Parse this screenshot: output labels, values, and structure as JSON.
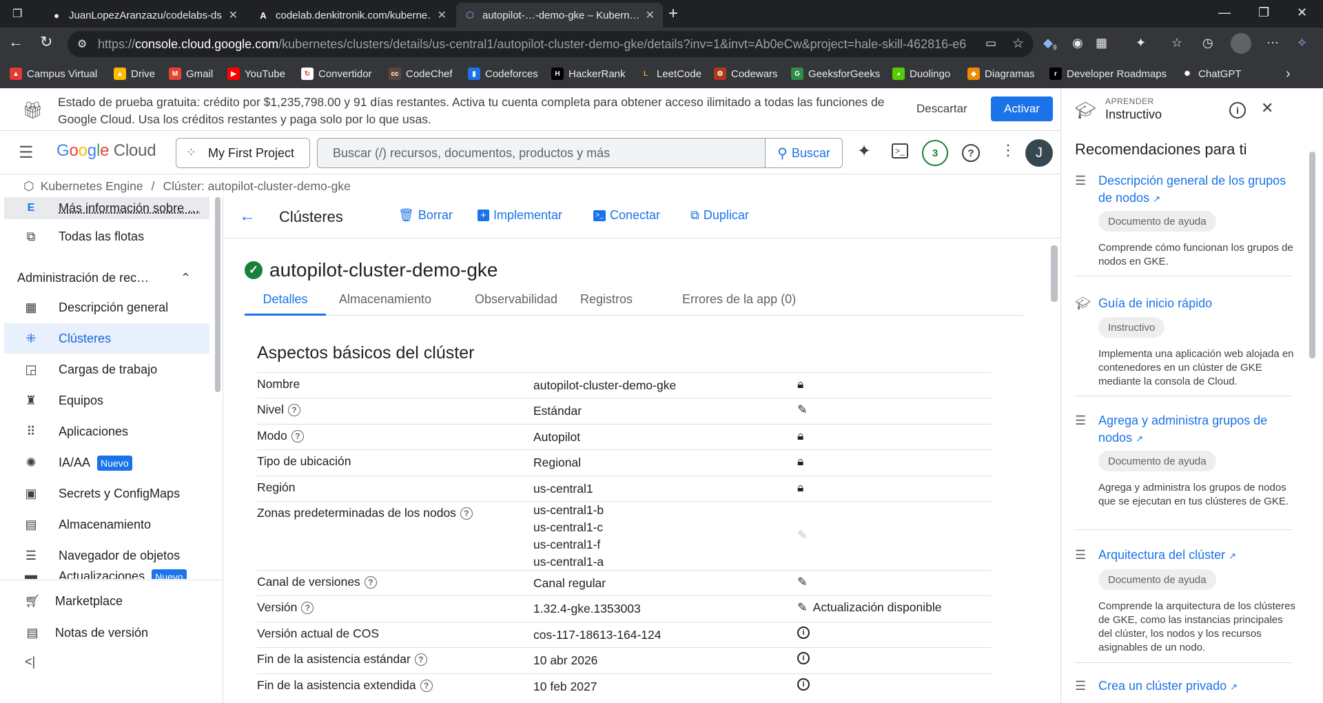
{
  "browser": {
    "tabs": [
      {
        "label": "JuanLopezAranzazu/codelabs-ds…",
        "icon": "github-icon"
      },
      {
        "label": "codelab.denkitronik.com/kuberne…",
        "icon": "codelab-icon"
      },
      {
        "label": "autopilot-…-demo-gke – Kubern…",
        "icon": "kubernetes-icon"
      }
    ],
    "url_prefix": "https://",
    "url_host": "console.cloud.google.com",
    "url_path": "/kubernetes/clusters/details/us-central1/autopilot-cluster-demo-gke/details?inv=1&invt=Ab0eCw&project=hale-skill-462816-e6",
    "extension_badge": "9",
    "bookmarks": [
      "Campus Virtual",
      "Drive",
      "Gmail",
      "YouTube",
      "Convertidor",
      "CodeChef",
      "Codeforces",
      "HackerRank",
      "LeetCode",
      "Codewars",
      "GeeksforGeeks",
      "Duolingo",
      "Diagramas",
      "Developer Roadmaps",
      "ChatGPT"
    ]
  },
  "banner": {
    "text": "Estado de prueba gratuita: crédito por $1,235,798.00 y 91 días restantes. Activa tu cuenta completa para obtener acceso ilimitado a todas las funciones de Google Cloud. Usa los créditos restantes y paga solo por lo que usas.",
    "dismiss": "Descartar",
    "activate": "Activar"
  },
  "topbar": {
    "logo": "Google Cloud",
    "project": "My First Project",
    "search_placeholder": "Buscar (/) recursos, documentos, productos y más",
    "search_button": "Buscar",
    "notifications": "3",
    "avatar": "J"
  },
  "breadcrumb": {
    "product": "Kubernetes Engine",
    "separator": "/",
    "current": "Clúster: autopilot-cluster-demo-gke"
  },
  "leftnav": {
    "top_item": "Más información sobre …",
    "fleets": "Todas las flotas",
    "section": "Administración de rec…",
    "items": [
      {
        "label": "Descripción general",
        "icon": "overview-icon"
      },
      {
        "label": "Clústeres",
        "icon": "clusters-icon"
      },
      {
        "label": "Cargas de trabajo",
        "icon": "workloads-icon"
      },
      {
        "label": "Equipos",
        "icon": "teams-icon"
      },
      {
        "label": "Aplicaciones",
        "icon": "apps-icon"
      },
      {
        "label": "IA/AA",
        "icon": "ai-icon",
        "badge": "Nuevo"
      },
      {
        "label": "Secrets y ConfigMaps",
        "icon": "secrets-icon"
      },
      {
        "label": "Almacenamiento",
        "icon": "storage-icon"
      },
      {
        "label": "Navegador de objetos",
        "icon": "object-browser-icon"
      },
      {
        "label": "Actualizaciones",
        "icon": "upgrades-icon",
        "badge": "Nuevo"
      }
    ],
    "marketplace": "Marketplace",
    "release_notes": "Notas de versión"
  },
  "main": {
    "title": "Clústeres",
    "actions": {
      "delete": "Borrar",
      "deploy": "Implementar",
      "connect": "Conectar",
      "duplicate": "Duplicar"
    },
    "cluster_name": "autopilot-cluster-demo-gke",
    "tabs": [
      "Detalles",
      "Almacenamiento",
      "Observabilidad",
      "Registros",
      "Errores de la app (0)"
    ],
    "section_title": "Aspectos básicos del clúster",
    "rows": [
      {
        "key": "Nombre",
        "value": "autopilot-cluster-demo-gke",
        "action": "lock"
      },
      {
        "key": "Nivel",
        "value": "Estándar",
        "action": "edit",
        "help": true
      },
      {
        "key": "Modo",
        "value": "Autopilot",
        "action": "lock",
        "help": true
      },
      {
        "key": "Tipo de ubicación",
        "value": "Regional",
        "action": "lock"
      },
      {
        "key": "Región",
        "value": "us-central1",
        "action": "lock"
      },
      {
        "key": "Zonas predeterminadas de los nodos",
        "values": [
          "us-central1-b",
          "us-central1-c",
          "us-central1-f",
          "us-central1-a"
        ],
        "action": "edit-disabled",
        "help": true
      },
      {
        "key": "Canal de versiones",
        "value": "Canal regular",
        "action": "edit",
        "help": true
      },
      {
        "key": "Versión",
        "value": "1.32.4-gke.1353003",
        "action": "edit",
        "action_label": "Actualización disponible",
        "help": true
      },
      {
        "key": "Versión actual de COS",
        "value": "cos-117-18613-164-124",
        "action": "info"
      },
      {
        "key": "Fin de la asistencia estándar",
        "value": "10 abr 2026",
        "action": "info",
        "help": true
      },
      {
        "key": "Fin de la asistencia extendida",
        "value": "10 feb 2027",
        "action": "info",
        "help": true
      }
    ]
  },
  "rightpanel": {
    "kicker": "APRENDER",
    "title": "Instructivo",
    "heading": "Recomendaciones para ti",
    "recs": [
      {
        "title": "Descripción general de los grupos de nodos",
        "chip": "Documento de ayuda",
        "desc": "Comprende cómo funcionan los grupos de nodos en GKE.",
        "external": true
      },
      {
        "title": "Guía de inicio rápido",
        "chip": "Instructivo",
        "desc": "Implementa una aplicación web alojada en contenedores en un clúster de GKE mediante la consola de Cloud.",
        "external": false
      },
      {
        "title": "Agrega y administra grupos de nodos",
        "chip": "Documento de ayuda",
        "desc": "Agrega y administra los grupos de nodos que se ejecutan en tus clústeres de GKE.",
        "external": true
      },
      {
        "title": "Arquitectura del clúster",
        "chip": "Documento de ayuda",
        "desc": "Comprende la arquitectura de los clústeres de GKE, como las instancias principales del clúster, los nodos y los recursos asignables de un nodo.",
        "external": true
      },
      {
        "title": "Crea un clúster privado",
        "external": true
      }
    ]
  },
  "colors": {
    "accent": "#1a73e8",
    "success": "#188038",
    "chrome_dark": "#202124"
  }
}
